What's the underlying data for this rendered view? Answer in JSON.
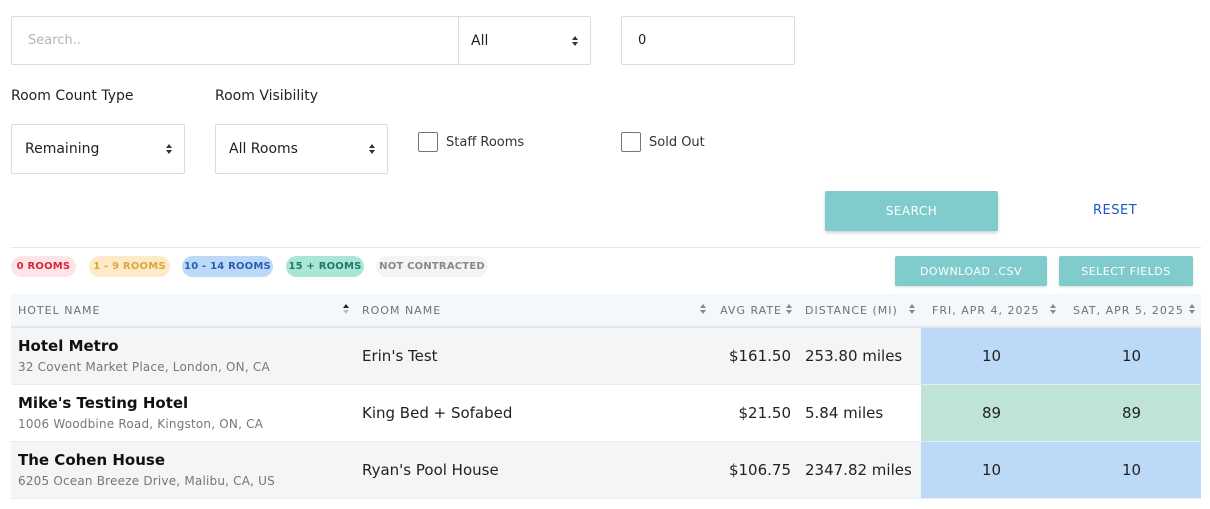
{
  "filters": {
    "search_placeholder": "Search..",
    "category_select": "All",
    "number_input": "0",
    "room_count_type_label": "Room Count Type",
    "room_count_type_value": "Remaining",
    "room_visibility_label": "Room Visibility",
    "room_visibility_value": "All Rooms",
    "staff_rooms_label": "Staff Rooms",
    "sold_out_label": "Sold Out",
    "search_button": "SEARCH",
    "reset_link": "RESET"
  },
  "legend": {
    "zero": "0 ROOMS",
    "one_nine": "1 - 9 ROOMS",
    "ten_fourteen": "10 - 14 ROOMS",
    "fifteen_plus": "15 + ROOMS",
    "not_contracted": "NOT CONTRACTED"
  },
  "actions": {
    "download_csv": "DOWNLOAD .CSV",
    "select_fields": "SELECT FIELDS"
  },
  "colors": {
    "accent": "#80cbcb",
    "link": "#1f57c9",
    "legend_zero_bg": "#fde4e7",
    "legend_zero_fg": "#d9263f",
    "legend_low_bg": "#fdebc8",
    "legend_low_fg": "#e0a43a",
    "legend_mid_bg": "#bcd9f7",
    "legend_mid_fg": "#2a5fb0",
    "legend_high_bg": "#a9e6d8",
    "legend_high_fg": "#1f7a63",
    "legend_nc_bg": "#f3f4f5",
    "legend_nc_fg": "#888888",
    "cell_mid": "#bcd9f7",
    "cell_high": "#bfe3d7"
  },
  "table": {
    "columns": [
      "HOTEL NAME",
      "ROOM NAME",
      "AVG RATE",
      "DISTANCE (MI)",
      "FRI, APR 4, 2025",
      "SAT, APR 5, 2025"
    ],
    "rows": [
      {
        "hotel": "Hotel Metro",
        "address": "32 Covent Market Place, London, ON, CA",
        "room": "Erin's Test",
        "rate": "$161.50",
        "distance": "253.80 miles",
        "d1": "10",
        "d2": "10",
        "tier": "mid"
      },
      {
        "hotel": "Mike's Testing Hotel",
        "address": "1006 Woodbine Road, Kingston, ON, CA",
        "room": "King Bed + Sofabed",
        "rate": "$21.50",
        "distance": "5.84 miles",
        "d1": "89",
        "d2": "89",
        "tier": "high"
      },
      {
        "hotel": "The Cohen House",
        "address": "6205 Ocean Breeze Drive, Malibu, CA, US",
        "room": "Ryan's Pool House",
        "rate": "$106.75",
        "distance": "2347.82 miles",
        "d1": "10",
        "d2": "10",
        "tier": "mid"
      }
    ]
  }
}
